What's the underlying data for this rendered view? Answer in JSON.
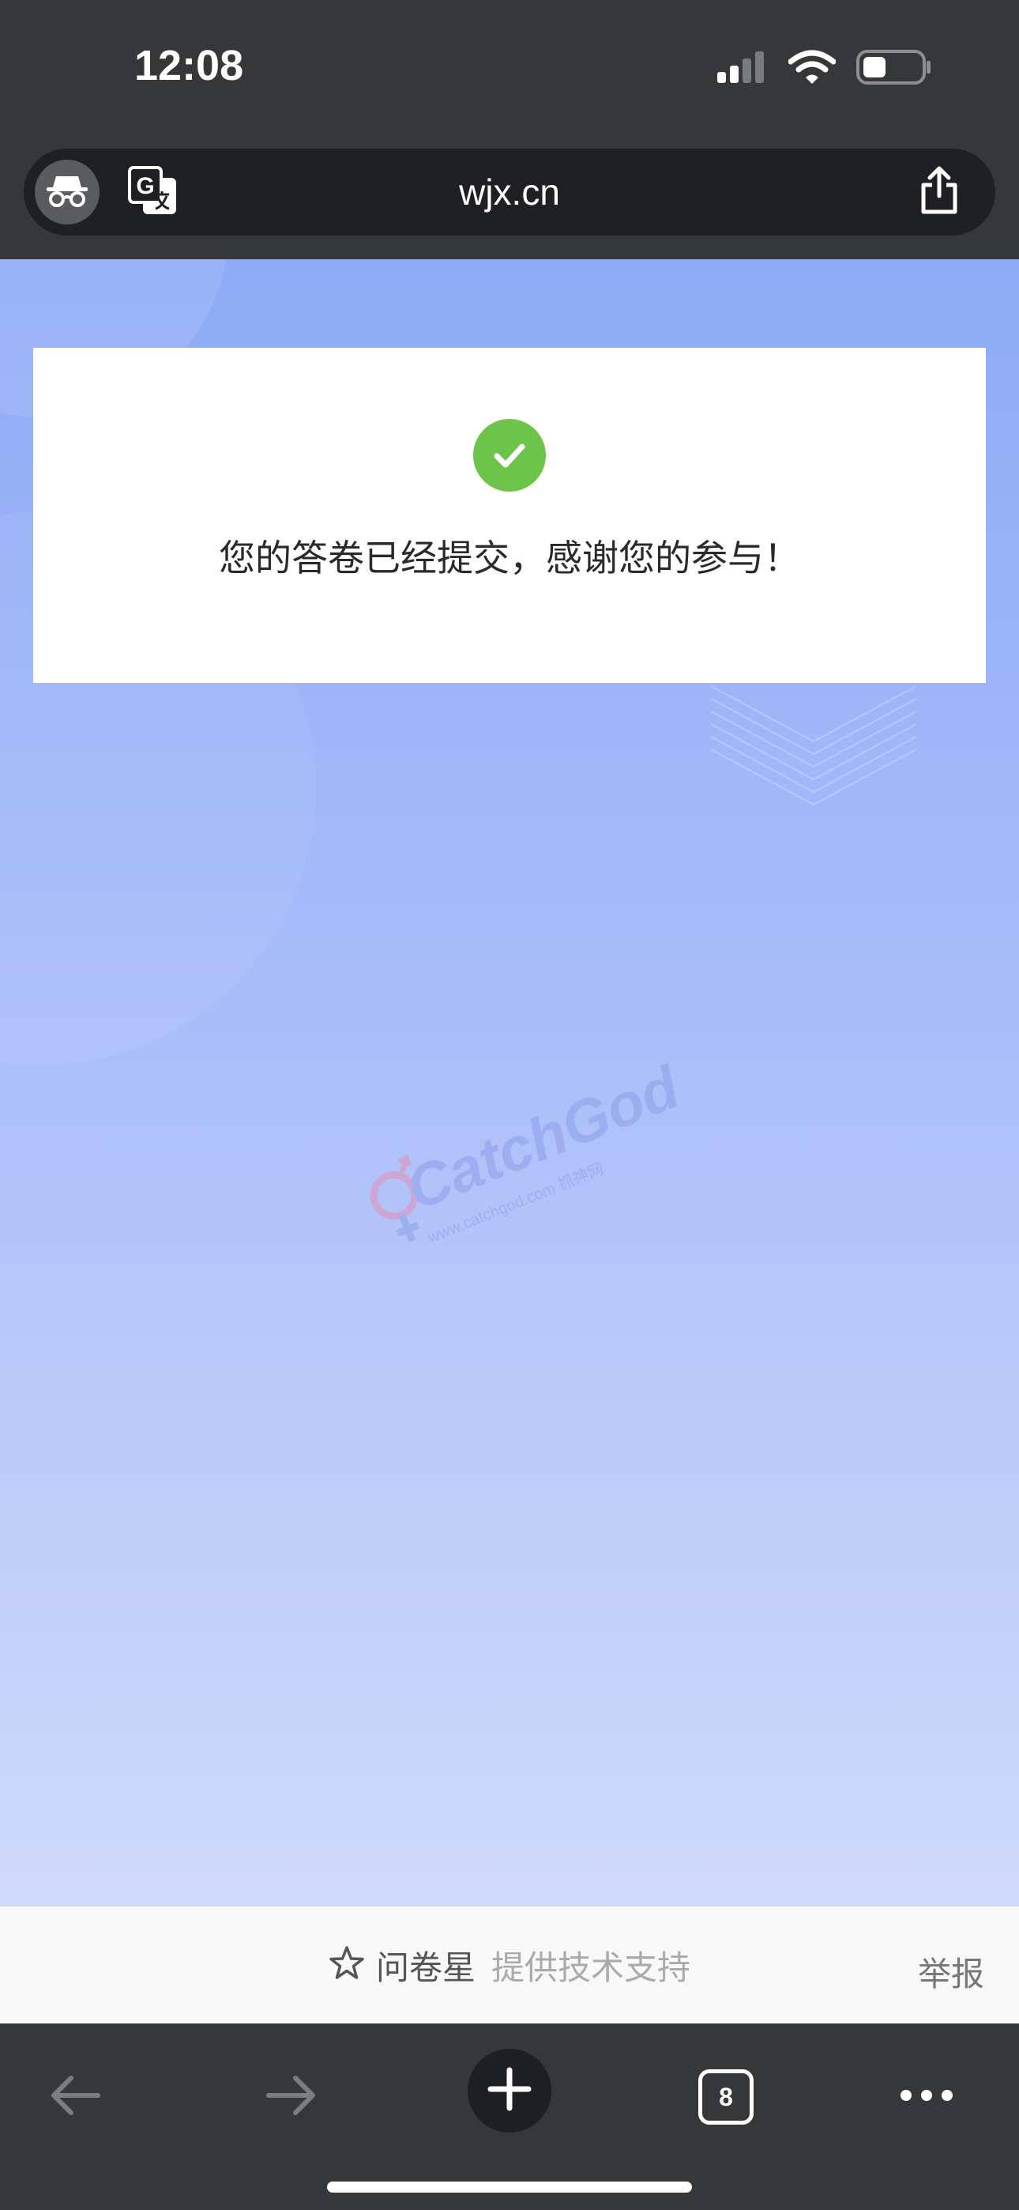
{
  "status_bar": {
    "time": "12:08",
    "icons": [
      "cellular-signal-icon",
      "wifi-icon",
      "battery-icon"
    ]
  },
  "browser": {
    "url": "wjx.cn",
    "icons": [
      "incognito-icon",
      "translate-icon",
      "share-icon"
    ]
  },
  "page": {
    "success_message": "您的答卷已经提交，感谢您的参与！",
    "watermark": {
      "brand": "CatchGod",
      "sub": "www.catchgod.com 抓神网"
    },
    "footer": {
      "brand_name": "问卷星",
      "support_text": "提供技术支持",
      "report_label": "举报"
    }
  },
  "toolbar": {
    "tab_count": "8",
    "icons": [
      "back-arrow-icon",
      "forward-arrow-icon",
      "plus-icon",
      "tabs-icon",
      "more-icon"
    ]
  },
  "colors": {
    "chrome": "#363739",
    "url_field": "#1f2023",
    "success_green": "#6cc54a",
    "page_gradient_top": "#8eaaf6",
    "page_gradient_bottom": "#cfdafb"
  }
}
